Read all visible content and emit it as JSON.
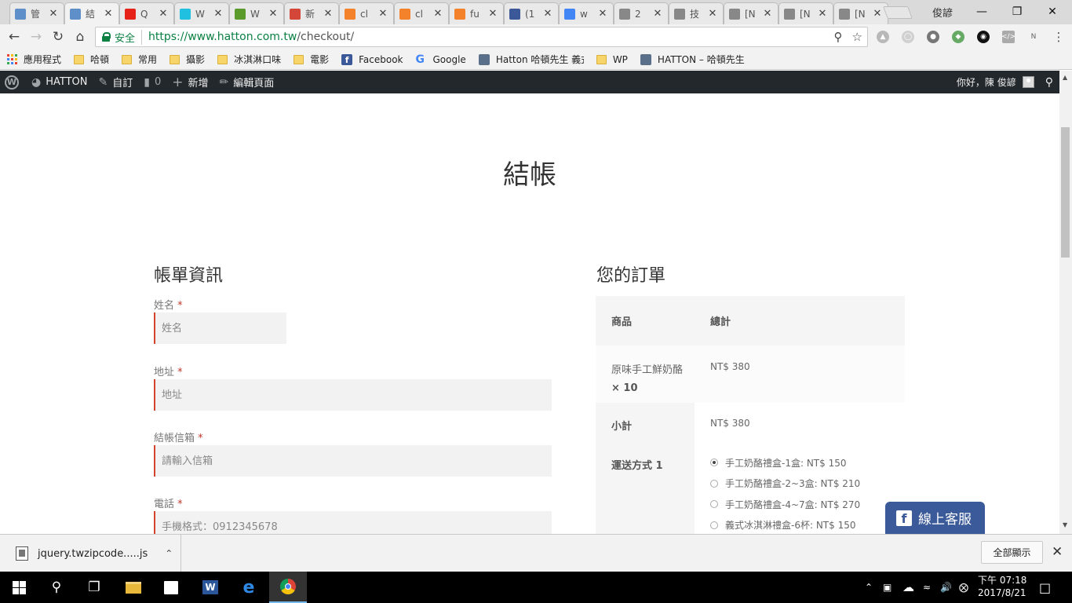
{
  "browser": {
    "tabs": [
      {
        "title": "管",
        "icon": "hatton-logo-icon",
        "color": "#5f8fc9"
      },
      {
        "title": "結",
        "icon": "hatton-logo-icon",
        "color": "#5f8fc9",
        "active": true
      },
      {
        "title": "Q",
        "icon": "youtube-icon",
        "color": "#e62117"
      },
      {
        "title": "W",
        "icon": "wix-icon",
        "color": "#20c1e0"
      },
      {
        "title": "W",
        "icon": "leaf-icon",
        "color": "#5a9a2a"
      },
      {
        "title": "新",
        "icon": "gmail-icon",
        "color": "#d44638"
      },
      {
        "title": "cl",
        "icon": "cloud-icon",
        "color": "#f4822a"
      },
      {
        "title": "cl",
        "icon": "cloud-icon",
        "color": "#f4822a"
      },
      {
        "title": "fu",
        "icon": "cloud-icon",
        "color": "#f4822a"
      },
      {
        "title": "(1",
        "icon": "facebook-icon",
        "color": "#3b5998"
      },
      {
        "title": "w",
        "icon": "google-icon",
        "color": "#4285f4"
      },
      {
        "title": "2",
        "icon": "document-icon",
        "color": "#888888"
      },
      {
        "title": "技",
        "icon": "document-icon",
        "color": "#888888"
      },
      {
        "title": "[N",
        "icon": "document-icon",
        "color": "#888888"
      },
      {
        "title": "[N",
        "icon": "document-icon",
        "color": "#888888"
      },
      {
        "title": "[N",
        "icon": "document-icon",
        "color": "#888888"
      }
    ],
    "profile_name": "俊諺",
    "security_label": "安全",
    "url_scheme_host": "https://www.hatton.com.tw",
    "url_path": "/checkout/"
  },
  "bookmarks": [
    {
      "label": "應用程式",
      "type": "apps"
    },
    {
      "label": "哈頓",
      "type": "folder"
    },
    {
      "label": "常用",
      "type": "folder"
    },
    {
      "label": "攝影",
      "type": "folder"
    },
    {
      "label": "冰淇淋口味",
      "type": "folder"
    },
    {
      "label": "電影",
      "type": "folder"
    },
    {
      "label": "Facebook",
      "type": "facebook"
    },
    {
      "label": "Google",
      "type": "google"
    },
    {
      "label": "Hatton 哈頓先生 義式",
      "type": "site"
    },
    {
      "label": "WP",
      "type": "folder"
    },
    {
      "label": "HATTON – 哈頓先生",
      "type": "site"
    }
  ],
  "wpbar": {
    "site_name": "HATTON",
    "customize": "自訂",
    "comments": "0",
    "new": "新增",
    "edit_page": "編輯頁面",
    "greeting": "你好，陳 俊諺"
  },
  "page": {
    "title": "結帳",
    "billing": {
      "heading": "帳單資訊",
      "fields": {
        "name": {
          "label": "姓名",
          "placeholder": "姓名"
        },
        "address": {
          "label": "地址",
          "placeholder": "地址"
        },
        "email": {
          "label": "結帳信箱",
          "placeholder": "請輸入信箱"
        },
        "phone": {
          "label": "電話",
          "placeholder": "手機格式：0912345678"
        }
      },
      "required_mark": "*"
    },
    "order": {
      "heading": "您的訂單",
      "col_product": "商品",
      "col_total": "總計",
      "item_name": "原味手工鮮奶酪",
      "item_qty": "× 10",
      "item_total": "NT$ 380",
      "subtotal_label": "小計",
      "subtotal_value": "NT$ 380",
      "shipping_label": "運送方式 1",
      "shipping_options": [
        {
          "label": "手工奶酪禮盒-1盒: NT$ 150",
          "selected": true
        },
        {
          "label": "手工奶酪禮盒-2~3盒: NT$ 210",
          "selected": false
        },
        {
          "label": "手工奶酪禮盒-4~7盒: NT$ 270",
          "selected": false
        },
        {
          "label": "義式冰淇淋禮盒-6杯: NT$ 150",
          "selected": false
        }
      ]
    },
    "fb_chat": "線上客服"
  },
  "downloads": {
    "file_name": "jquery.twzipcode.....js",
    "show_all": "全部顯示"
  },
  "taskbar": {
    "time": "下午 07:18",
    "date": "2017/8/21"
  }
}
